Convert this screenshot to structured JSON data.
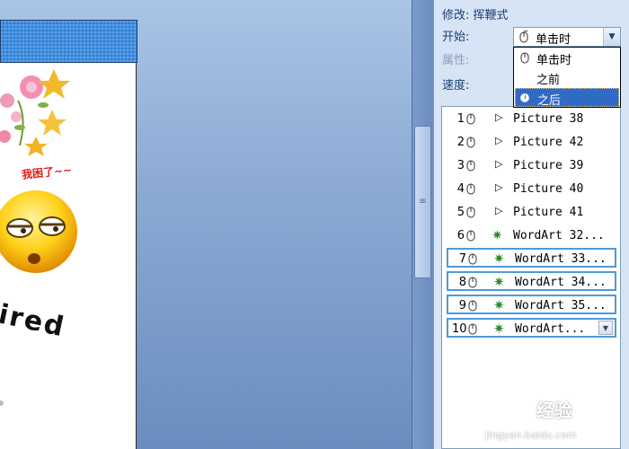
{
  "slide": {
    "caption": "我困了~~",
    "text": "ired"
  },
  "pane": {
    "modify_label": "修改: 挥鞭式",
    "start_label": "开始:",
    "property_label": "属性:",
    "speed_label": "速度:",
    "start_combo_value": "单击时",
    "dropdown_options": [
      "单击时",
      "之前",
      "之后"
    ],
    "selected_option": "之后"
  },
  "animation_list": [
    {
      "num": "1",
      "effect": "Picture 38"
    },
    {
      "num": "2",
      "effect": "Picture 42"
    },
    {
      "num": "3",
      "effect": "Picture 39"
    },
    {
      "num": "4",
      "effect": "Picture 40"
    },
    {
      "num": "5",
      "effect": "Picture 41"
    },
    {
      "num": "6",
      "effect": "WordArt 32..."
    },
    {
      "num": "7",
      "effect": "WordArt 33..."
    },
    {
      "num": "8",
      "effect": "WordArt 34..."
    },
    {
      "num": "9",
      "effect": "WordArt 35..."
    },
    {
      "num": "10",
      "effect": "WordArt..."
    }
  ],
  "watermark": {
    "text": "经验",
    "url": "jingyan.baidu.com"
  }
}
